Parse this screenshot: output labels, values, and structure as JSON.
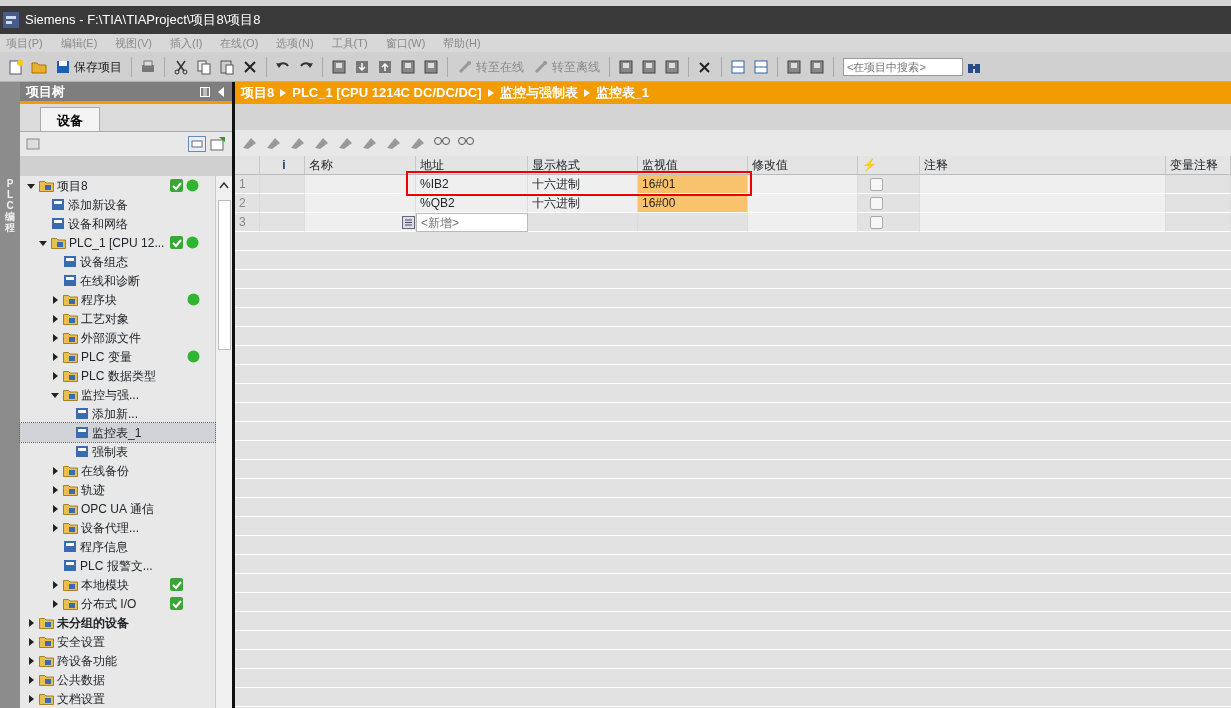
{
  "window": {
    "title": "Siemens  -  F:\\TIA\\TIAProject\\项目8\\项目8"
  },
  "menu": [
    "项目(P)",
    "编辑(E)",
    "视图(V)",
    "插入(I)",
    "在线(O)",
    "选项(N)",
    "工具(T)",
    "窗口(W)",
    "帮助(H)"
  ],
  "toolbar": {
    "items": [
      {
        "kind": "new"
      },
      {
        "kind": "open"
      },
      {
        "kind": "save",
        "label": "保存项目"
      },
      {
        "kind": "sep"
      },
      {
        "kind": "print"
      },
      {
        "kind": "sep"
      },
      {
        "kind": "cut"
      },
      {
        "kind": "copy"
      },
      {
        "kind": "paste"
      },
      {
        "kind": "delete"
      },
      {
        "kind": "sep"
      },
      {
        "kind": "undo"
      },
      {
        "kind": "redo"
      },
      {
        "kind": "sep"
      },
      {
        "kind": "device"
      },
      {
        "kind": "download"
      },
      {
        "kind": "upload"
      },
      {
        "kind": "device"
      },
      {
        "kind": "device"
      },
      {
        "kind": "sep"
      },
      {
        "kind": "online",
        "label": "转至在线"
      },
      {
        "kind": "online",
        "label": "转至离线"
      },
      {
        "kind": "sep"
      },
      {
        "kind": "device"
      },
      {
        "kind": "device"
      },
      {
        "kind": "device"
      },
      {
        "kind": "sep"
      },
      {
        "kind": "close"
      },
      {
        "kind": "sep"
      },
      {
        "kind": "split"
      },
      {
        "kind": "split"
      },
      {
        "kind": "sep"
      },
      {
        "kind": "device"
      },
      {
        "kind": "device"
      }
    ],
    "search": {
      "placeholder": "<在项目中搜索>"
    }
  },
  "side_strip": {
    "label": "PLC 编程"
  },
  "project_tree": {
    "title": "项目树",
    "tabs": [
      {
        "label": "设备",
        "selected": true
      }
    ],
    "items": [
      {
        "label": "项目8",
        "expanded": true,
        "consistent": true,
        "online": true,
        "children": [
          {
            "label": "添加新设备"
          },
          {
            "label": "设备和网络"
          },
          {
            "label": "PLC_1 [CPU 12...",
            "expanded": true,
            "consistent": true,
            "online": true,
            "children": [
              {
                "label": "设备组态"
              },
              {
                "label": "在线和诊断"
              },
              {
                "label": "程序块",
                "expanded": false,
                "online": true
              },
              {
                "label": "工艺对象",
                "expanded": false
              },
              {
                "label": "外部源文件",
                "expanded": false
              },
              {
                "label": "PLC 变量",
                "expanded": false,
                "online": true
              },
              {
                "label": "PLC 数据类型",
                "expanded": false
              },
              {
                "label": "监控与强...",
                "expanded": true,
                "children": [
                  {
                    "label": "添加新..."
                  },
                  {
                    "label": "监控表_1",
                    "selected": true
                  },
                  {
                    "label": "强制表"
                  }
                ]
              },
              {
                "label": "在线备份",
                "expanded": false
              },
              {
                "label": "轨迹",
                "expanded": false
              },
              {
                "label": "OPC UA 通信",
                "expanded": false
              },
              {
                "label": "设备代理...",
                "expanded": false
              },
              {
                "label": "程序信息"
              },
              {
                "label": "PLC 报警文..."
              },
              {
                "label": "本地模块",
                "expanded": false,
                "consistent": true
              },
              {
                "label": "分布式 I/O",
                "expanded": false,
                "consistent": true
              }
            ]
          }
        ]
      },
      {
        "label": "未分组的设备",
        "expanded": false,
        "bold": true
      },
      {
        "label": "安全设置",
        "expanded": false
      },
      {
        "label": "跨设备功能",
        "expanded": false
      },
      {
        "label": "公共数据",
        "expanded": false
      },
      {
        "label": "文档设置",
        "expanded": false
      }
    ]
  },
  "breadcrumb": [
    "项目8",
    "PLC_1 [CPU 1214C DC/DC/DC]",
    "监控与强制表",
    "监控表_1"
  ],
  "watch_table": {
    "columns": [
      "i",
      "名称",
      "地址",
      "显示格式",
      "监视值",
      "修改值",
      "⚡",
      "注释",
      "变量注释"
    ],
    "rows": [
      {
        "index": "1",
        "address": "%IB2",
        "format": "十六进制",
        "monitor_value": "16#01",
        "highlighted": true,
        "checked": false
      },
      {
        "index": "2",
        "address": "%QB2",
        "format": "十六进制",
        "monitor_value": "16#00",
        "highlighted": false,
        "checked": false
      },
      {
        "index": "3",
        "placeholder": "<新增>",
        "checked": false
      }
    ]
  }
}
